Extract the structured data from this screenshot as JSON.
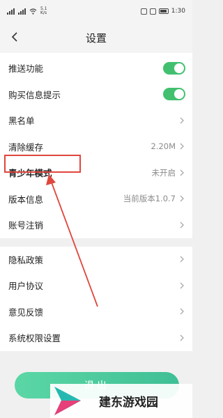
{
  "status_bar": {
    "network": "5.1\nK/s",
    "time": "1:30"
  },
  "nav": {
    "title": "设置"
  },
  "group1": [
    {
      "label": "推送功能",
      "type": "toggle",
      "on": true
    },
    {
      "label": "购买信息提示",
      "type": "toggle",
      "on": true
    },
    {
      "label": "黑名单",
      "type": "link"
    },
    {
      "label": "清除缓存",
      "type": "value",
      "value": "2.20M"
    },
    {
      "label": "青少年模式",
      "type": "value",
      "value": "未开启"
    },
    {
      "label": "版本信息",
      "type": "value",
      "value": "当前版本1.0.7"
    },
    {
      "label": "账号注销",
      "type": "link"
    }
  ],
  "group2": [
    {
      "label": "隐私政策",
      "type": "link"
    },
    {
      "label": "用户协议",
      "type": "link"
    },
    {
      "label": "意见反馈",
      "type": "link"
    },
    {
      "label": "系统权限设置",
      "type": "link"
    }
  ],
  "logout_label": "退出",
  "watermark": {
    "text": "建东游戏园"
  },
  "colors": {
    "toggle_on": "#42c06f",
    "annotation": "#e0463c",
    "logout": "#4cc99d"
  }
}
